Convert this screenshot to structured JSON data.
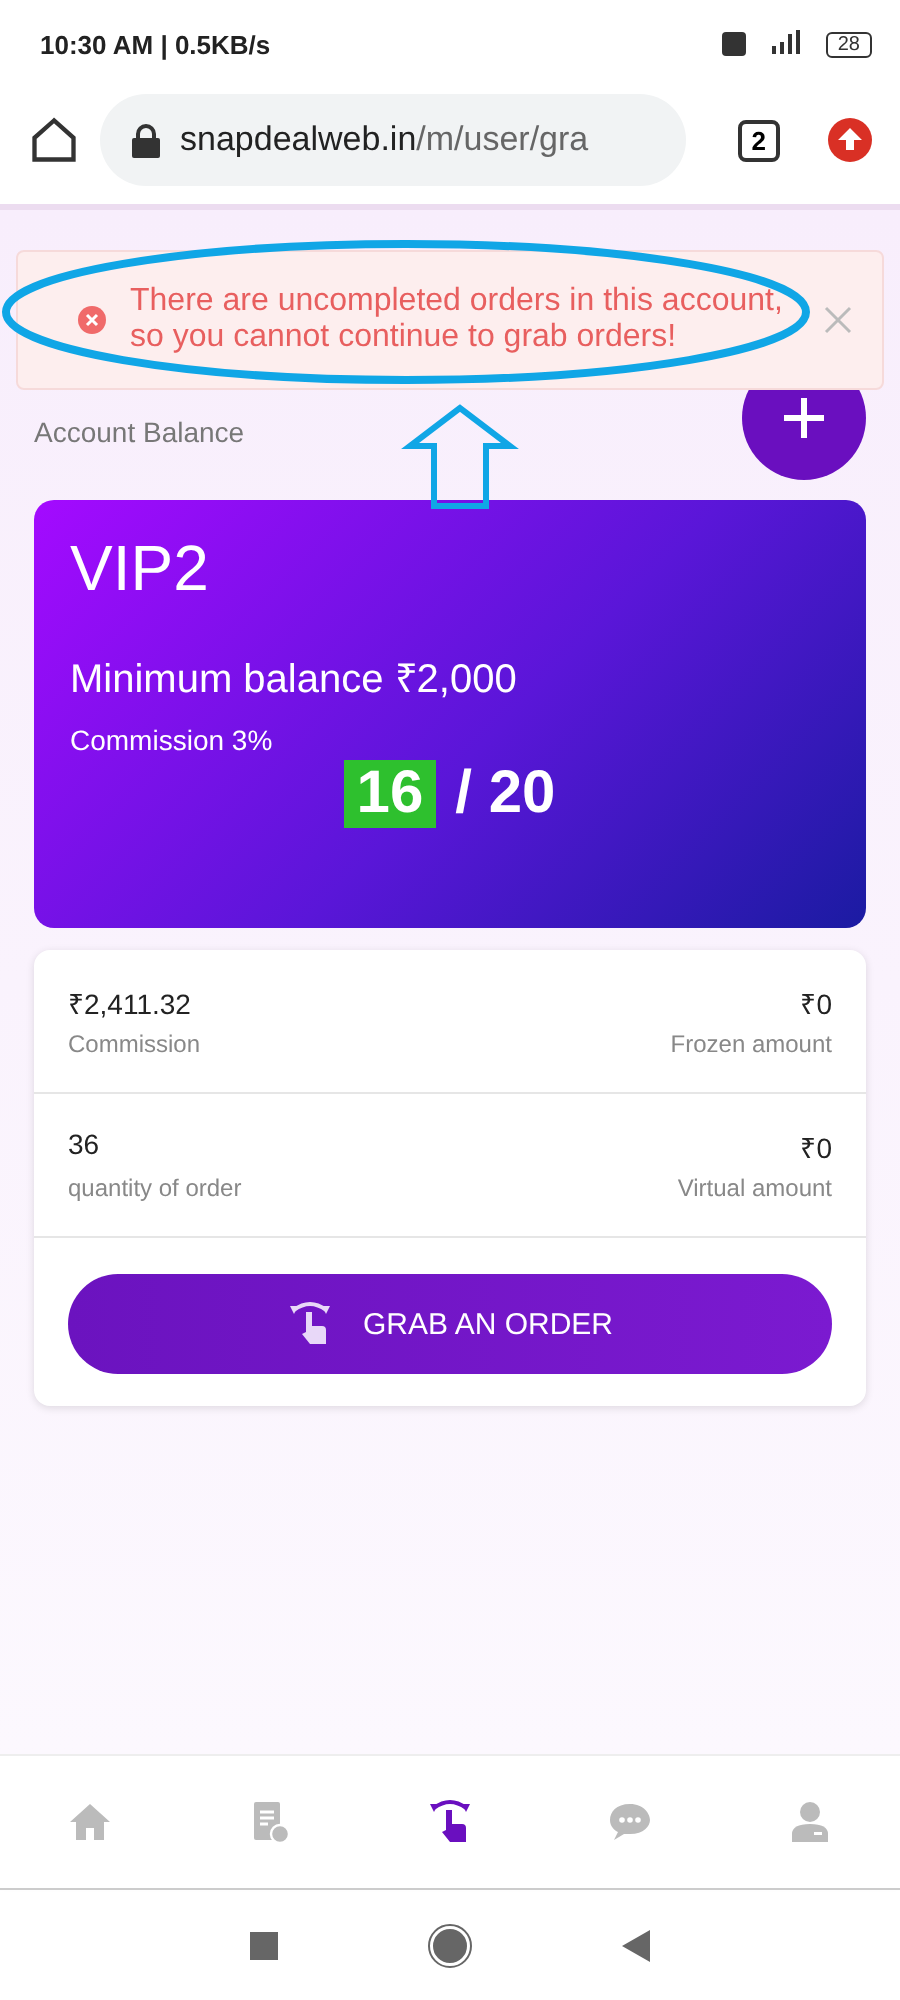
{
  "status_bar": {
    "time": "10:30 AM | 0.5KB/s",
    "battery": "28"
  },
  "browser": {
    "url_host": "snapdealweb.in",
    "url_path": "/m/user/gra",
    "tab_count": "2"
  },
  "toast": {
    "message": "There are uncompleted orders in this account, so you cannot continue to grab orders!"
  },
  "account": {
    "label": "Account Balance"
  },
  "vip_card": {
    "level": "VIP2",
    "minimum_balance": "Minimum balance ₹2,000",
    "commission": "Commission 3%",
    "done": "16",
    "total": "/ 20"
  },
  "stats": [
    {
      "left_value": "₹2,411.32",
      "left_label": "Commission",
      "right_value": "₹0",
      "right_label": "Frozen amount"
    },
    {
      "left_value": "36",
      "left_label": "quantity of order",
      "right_value": "₹0",
      "right_label": "Virtual amount"
    }
  ],
  "grab_button": "GRAB AN ORDER",
  "bottom_nav": [
    {
      "selected": false
    },
    {
      "selected": false
    },
    {
      "selected": true
    },
    {
      "selected": false
    },
    {
      "selected": false
    }
  ]
}
